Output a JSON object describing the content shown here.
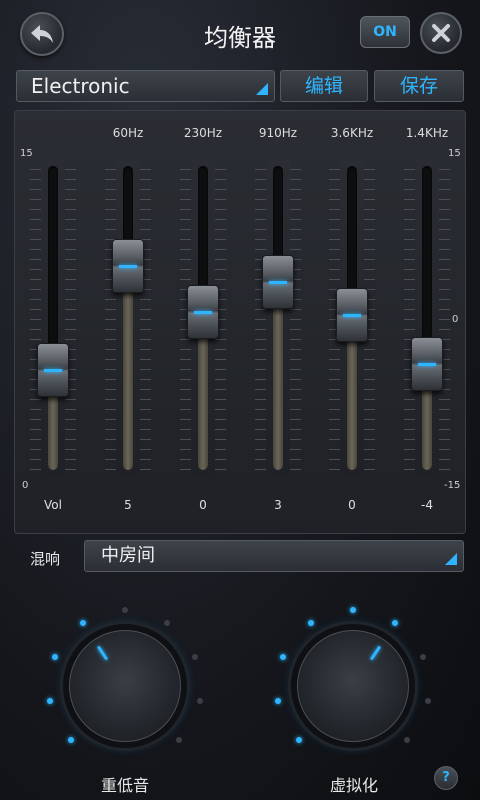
{
  "header": {
    "title": "均衡器",
    "on_label": "ON",
    "back_icon": "back-arrow-icon",
    "close_icon": "close-icon"
  },
  "preset": {
    "selected": "Electronic",
    "edit_label": "编辑",
    "save_label": "保存"
  },
  "equalizer": {
    "scale": {
      "top": "15",
      "left_bottom": "0",
      "right_mid": "0",
      "right_bottom": "-15"
    },
    "bands": [
      {
        "freq": "",
        "value_label": "Vol",
        "level": 0.33
      },
      {
        "freq": "60Hz",
        "value_label": "5",
        "level": 0.67
      },
      {
        "freq": "230Hz",
        "value_label": "0",
        "level": 0.52
      },
      {
        "freq": "910Hz",
        "value_label": "3",
        "level": 0.62
      },
      {
        "freq": "3.6KHz",
        "value_label": "0",
        "level": 0.51
      },
      {
        "freq": "1.4KHz",
        "value_label": "-4",
        "level": 0.35
      }
    ]
  },
  "reverb": {
    "label": "混响",
    "selected": "中房间"
  },
  "dials": {
    "bass": {
      "label": "重低音",
      "active_dots": 4,
      "total_dots": 9
    },
    "virtualizer": {
      "label": "虚拟化",
      "active_dots": 6,
      "total_dots": 9
    }
  },
  "help_label": "?",
  "colors": {
    "accent": "#2fb5ff",
    "panel": "#2a2d33"
  }
}
